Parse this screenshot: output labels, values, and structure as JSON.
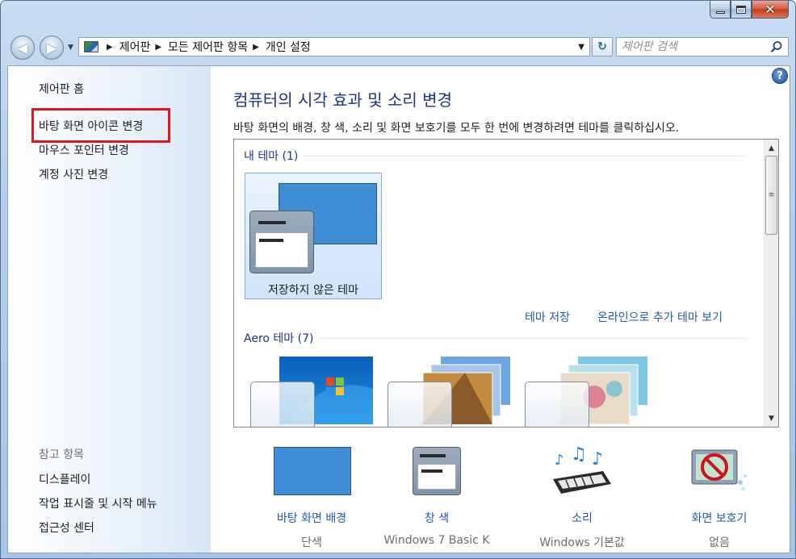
{
  "window": {
    "minimize": "",
    "maximize": "",
    "close": "✕"
  },
  "address": {
    "crumbs": [
      "제어판",
      "모든 제어판 항목",
      "개인 설정"
    ],
    "search_placeholder": "제어판 검색"
  },
  "sidebar": {
    "home": "제어판 홈",
    "links": [
      "바탕 화면 아이콘 변경",
      "마우스 포인터 변경",
      "계정 사진 변경"
    ],
    "see_also_heading": "참고 항목",
    "see_also": [
      "디스플레이",
      "작업 표시줄 및 시작 메뉴",
      "접근성 센터"
    ]
  },
  "main": {
    "title": "컴퓨터의 시각 효과 및 소리 변경",
    "description": "바탕 화면의 배경, 창 색, 소리 및 화면 보호기를 모두 한 번에 변경하려면 테마를 클릭하십시오.",
    "my_themes_heading": "내 테마 (1)",
    "unsaved_theme_label": "저장하지 않은 테마",
    "save_theme_link": "테마 저장",
    "online_themes_link": "온라인으로 추가 테마 보기",
    "aero_heading": "Aero 테마 (7)"
  },
  "bottom": [
    {
      "label": "바탕 화면 배경",
      "sub": "단색",
      "icon": "desktop-background-icon"
    },
    {
      "label": "창 색",
      "sub": "Windows 7 Basic K",
      "icon": "window-color-icon"
    },
    {
      "label": "소리",
      "sub": "Windows 기본값",
      "icon": "sounds-icon"
    },
    {
      "label": "화면 보호기",
      "sub": "없음",
      "icon": "screen-saver-icon"
    }
  ],
  "colors": {
    "accent_link": "#1e5aa8",
    "title": "#1e3287",
    "highlight": "#e1151d",
    "solid_background": "#3f8dd5"
  }
}
